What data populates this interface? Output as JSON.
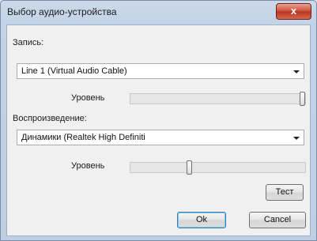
{
  "window": {
    "title": "Выбор аудио-устройства",
    "close_label": "x"
  },
  "recording": {
    "label": "Запись:",
    "device": "Line 1 (Virtual Audio Cable)",
    "level_label": "Уровень",
    "level": 1.0
  },
  "playback": {
    "label": "Воспроизведение:",
    "device": "Динамики (Realtek High Definiti",
    "level_label": "Уровень",
    "level": 0.33
  },
  "buttons": {
    "test": "Тест",
    "ok": "Ok",
    "cancel": "Cancel"
  }
}
